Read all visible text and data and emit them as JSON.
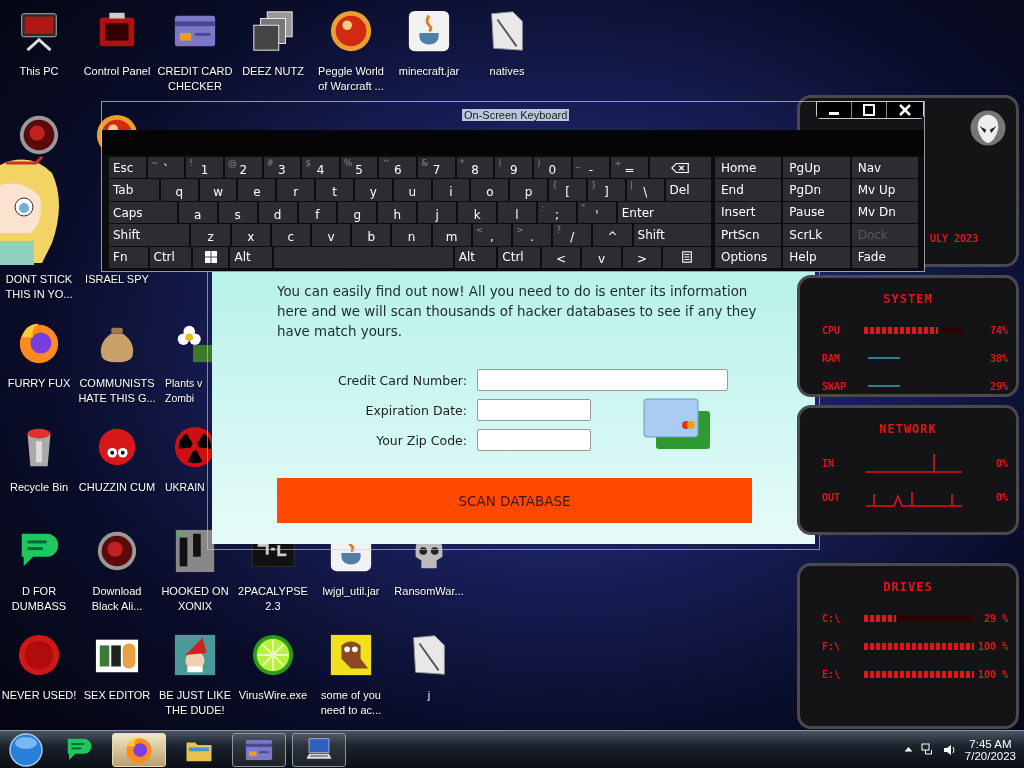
{
  "desktop_icons": [
    {
      "label": "This PC"
    },
    {
      "label": "Control Panel"
    },
    {
      "label": "CREDIT CARD CHECKER"
    },
    {
      "label": "DEEZ NUTZ"
    },
    {
      "label": "Peggle World of Warcraft ..."
    },
    {
      "label": "minecraft.jar"
    },
    {
      "label": "natives"
    },
    {
      "label": "DONT STICK THIS IN YO..."
    },
    {
      "label": "ISRAEL SPY"
    },
    {
      "label": "FURRY FUX"
    },
    {
      "label": "COMMUNISTS HATE THIS G..."
    },
    {
      "label": "Plants v Zombi"
    },
    {
      "label": "Recycle Bin"
    },
    {
      "label": "CHUZZIN CUM"
    },
    {
      "label": "UKRAIN"
    },
    {
      "label": "D FOR DUMBASS"
    },
    {
      "label": "Download Black Ali..."
    },
    {
      "label": "HOOKED ON XONIX"
    },
    {
      "label": "2PACALYPSE 2.3"
    },
    {
      "label": "lwjgl_util.jar"
    },
    {
      "label": "RansomWar..."
    },
    {
      "label": "NEVER USED!"
    },
    {
      "label": "SEX EDITOR"
    },
    {
      "label": "BE JUST LIKE THE DUDE!"
    },
    {
      "label": "VirusWire.exe"
    },
    {
      "label": "some of you need to ac..."
    },
    {
      "label": "j"
    }
  ],
  "form_window": {
    "intro": "You can easily find out now! All you need to do is enter its information here and we will scan thousands of hacker databases to see if any they have match yours.",
    "fields": [
      {
        "label": "Credit Card Number:",
        "kind": "long"
      },
      {
        "label": "Expiration Date:",
        "kind": "short"
      },
      {
        "label": "Your Zip Code:",
        "kind": "short"
      }
    ],
    "button": "SCAN DATABASE"
  },
  "keyboard": {
    "title": "On-Screen Keyboard",
    "rows": [
      [
        {
          "kind": "text",
          "label": "Esc"
        },
        {
          "kind": "char",
          "shift": "~",
          "label": "`"
        },
        {
          "kind": "char",
          "shift": "!",
          "label": "1"
        },
        {
          "kind": "char",
          "shift": "@",
          "label": "2"
        },
        {
          "kind": "char",
          "shift": "#",
          "label": "3"
        },
        {
          "kind": "char",
          "shift": "$",
          "label": "4"
        },
        {
          "kind": "char",
          "shift": "%",
          "label": "5"
        },
        {
          "kind": "char",
          "shift": "^",
          "label": "6"
        },
        {
          "kind": "char",
          "shift": "&",
          "label": "7"
        },
        {
          "kind": "char",
          "shift": "*",
          "label": "8"
        },
        {
          "kind": "char",
          "shift": "(",
          "label": "9"
        },
        {
          "kind": "char",
          "shift": ")",
          "label": "0"
        },
        {
          "kind": "char",
          "shift": "_",
          "label": "-"
        },
        {
          "kind": "char",
          "shift": "+",
          "label": "="
        },
        {
          "kind": "backspace"
        }
      ],
      [
        {
          "kind": "text",
          "label": "Tab"
        },
        {
          "kind": "char",
          "label": "q"
        },
        {
          "kind": "char",
          "label": "w"
        },
        {
          "kind": "char",
          "label": "e"
        },
        {
          "kind": "char",
          "label": "r"
        },
        {
          "kind": "char",
          "label": "t"
        },
        {
          "kind": "char",
          "label": "y"
        },
        {
          "kind": "char",
          "label": "u"
        },
        {
          "kind": "char",
          "label": "i"
        },
        {
          "kind": "char",
          "label": "o"
        },
        {
          "kind": "char",
          "label": "p"
        },
        {
          "kind": "char",
          "shift": "{",
          "label": "["
        },
        {
          "kind": "char",
          "shift": "}",
          "label": "]"
        },
        {
          "kind": "char",
          "shift": "|",
          "label": "\\"
        },
        {
          "kind": "text",
          "label": "Del"
        }
      ],
      [
        {
          "kind": "text",
          "label": "Caps"
        },
        {
          "kind": "char",
          "label": "a"
        },
        {
          "kind": "char",
          "label": "s"
        },
        {
          "kind": "char",
          "label": "d"
        },
        {
          "kind": "char",
          "label": "f"
        },
        {
          "kind": "char",
          "label": "g"
        },
        {
          "kind": "char",
          "label": "h"
        },
        {
          "kind": "char",
          "label": "j"
        },
        {
          "kind": "char",
          "label": "k"
        },
        {
          "kind": "char",
          "label": "l"
        },
        {
          "kind": "char",
          "shift": ":",
          "label": ";"
        },
        {
          "kind": "char",
          "shift": "\"",
          "label": "'"
        },
        {
          "kind": "text",
          "label": "Enter"
        }
      ],
      [
        {
          "kind": "text",
          "label": "Shift"
        },
        {
          "kind": "char",
          "label": "z"
        },
        {
          "kind": "char",
          "label": "x"
        },
        {
          "kind": "char",
          "label": "c"
        },
        {
          "kind": "char",
          "label": "v"
        },
        {
          "kind": "char",
          "label": "b"
        },
        {
          "kind": "char",
          "label": "n"
        },
        {
          "kind": "char",
          "label": "m"
        },
        {
          "kind": "char",
          "shift": "<",
          "label": ","
        },
        {
          "kind": "char",
          "shift": ">",
          "label": "."
        },
        {
          "kind": "char",
          "shift": "?",
          "label": "/"
        },
        {
          "kind": "char",
          "label": "^"
        },
        {
          "kind": "text",
          "label": "Shift"
        }
      ],
      [
        {
          "kind": "text",
          "label": "Fn"
        },
        {
          "kind": "text",
          "label": "Ctrl"
        },
        {
          "kind": "windows"
        },
        {
          "kind": "text",
          "label": "Alt"
        },
        {
          "kind": "space"
        },
        {
          "kind": "text",
          "label": "Alt"
        },
        {
          "kind": "text",
          "label": "Ctrl"
        },
        {
          "kind": "char",
          "label": "<"
        },
        {
          "kind": "char",
          "label": "v"
        },
        {
          "kind": "char",
          "label": ">"
        },
        {
          "kind": "menu"
        }
      ]
    ],
    "nav_keys": [
      {
        "label": "Home",
        "disabled": false
      },
      {
        "label": "PgUp",
        "disabled": false
      },
      {
        "label": "Nav",
        "disabled": false
      },
      {
        "label": "End",
        "disabled": false
      },
      {
        "label": "PgDn",
        "disabled": false
      },
      {
        "label": "Mv Up",
        "disabled": false
      },
      {
        "label": "Insert",
        "disabled": false
      },
      {
        "label": "Pause",
        "disabled": false
      },
      {
        "label": "Mv Dn",
        "disabled": false
      },
      {
        "label": "PrtScn",
        "disabled": false
      },
      {
        "label": "ScrLk",
        "disabled": false
      },
      {
        "label": "Dock",
        "disabled": true
      },
      {
        "label": "Options",
        "disabled": false
      },
      {
        "label": "Help",
        "disabled": false
      },
      {
        "label": "Fade",
        "disabled": false
      }
    ]
  },
  "widgets": {
    "date": "ULY 2023",
    "system": {
      "title": "SYSTEM",
      "meters": [
        {
          "kind": "bar",
          "label": "CPU",
          "level": 0.74,
          "reading": "74%"
        },
        {
          "kind": "line",
          "label": "RAM",
          "reading": "38%"
        },
        {
          "kind": "line",
          "label": "SWAP",
          "reading": "29%"
        }
      ]
    },
    "network": {
      "title": "NETWORK",
      "rows": [
        {
          "label": "IN",
          "reading": "0%"
        },
        {
          "label": "OUT",
          "reading": "0%"
        }
      ]
    },
    "drives": {
      "title": "DRIVES",
      "rows": [
        {
          "label": "C:\\",
          "level": 0.29,
          "reading": "29 %"
        },
        {
          "label": "F:\\",
          "level": 1,
          "reading": "100 %"
        },
        {
          "label": "E:\\",
          "level": 1,
          "reading": "100 %"
        }
      ]
    }
  },
  "taskbar": {
    "apps": [
      {
        "selected": false,
        "open": false
      },
      {
        "selected": true,
        "open": true
      },
      {
        "selected": false,
        "open": false
      },
      {
        "selected": false,
        "open": true
      },
      {
        "selected": false,
        "open": true
      }
    ],
    "time": "7:45 AM",
    "date": "7/20/2023"
  }
}
